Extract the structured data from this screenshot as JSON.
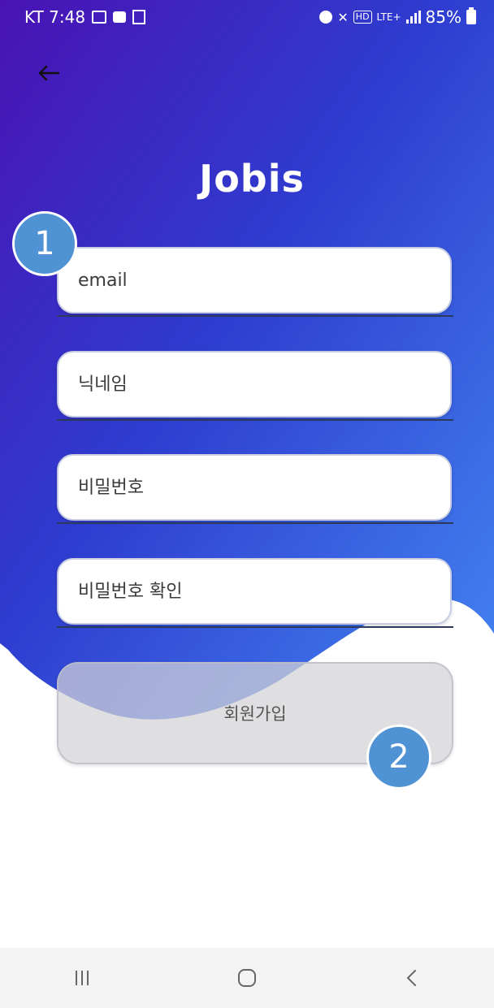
{
  "status_bar": {
    "carrier_time": "KT 7:48",
    "network": "LTE+",
    "hd_label": "HD",
    "battery": "85%"
  },
  "header": {
    "back_icon": "arrow-left-icon",
    "title": "Jobis"
  },
  "form": {
    "email_placeholder": "email",
    "nickname_placeholder": "닉네임",
    "password_placeholder": "비밀번호",
    "password_confirm_placeholder": "비밀번호 확인",
    "signup_label": "회원가입"
  },
  "annotations": {
    "badge_1": "1",
    "badge_2": "2"
  },
  "colors": {
    "gradient_start": "#4a12b4",
    "gradient_mid": "#2e3dd0",
    "gradient_end": "#3f7cf0",
    "badge": "#5093d4",
    "nav_bg": "#f3f3f3"
  },
  "nav_bar": {
    "recents_icon": "recents-icon",
    "home_icon": "home-icon",
    "back_icon": "nav-back-icon"
  }
}
